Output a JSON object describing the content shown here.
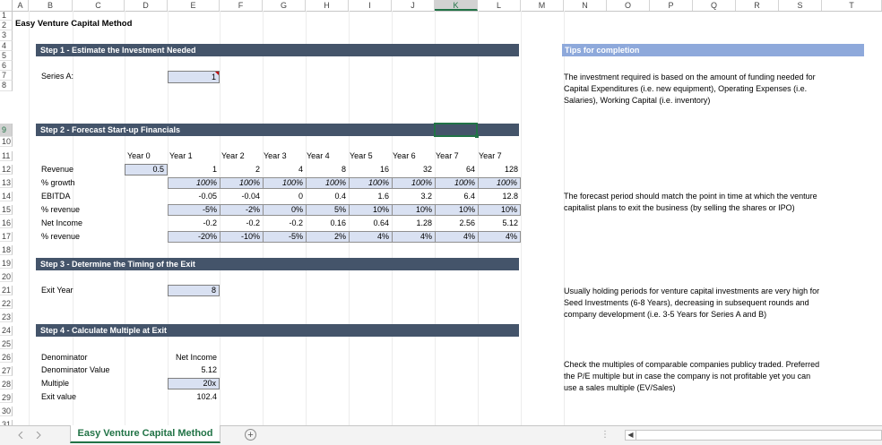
{
  "sheet": {
    "columns": [
      "A",
      "B",
      "C",
      "D",
      "E",
      "F",
      "G",
      "H",
      "I",
      "J",
      "K",
      "L",
      "M",
      "N",
      "O",
      "P",
      "Q",
      "R",
      "S",
      "T"
    ],
    "selected_column": "K",
    "rows": [
      "1",
      "2",
      "3",
      "4",
      "5",
      "6",
      "7",
      "8",
      "9",
      "10",
      "11",
      "12",
      "13",
      "14",
      "15",
      "16",
      "17",
      "18",
      "19",
      "20",
      "21",
      "22",
      "23",
      "24",
      "25",
      "26",
      "27",
      "28",
      "29",
      "30",
      "31"
    ],
    "selected_row": "9"
  },
  "title": "Easy Venture Capital Method",
  "step1": {
    "header": "Step 1 - Estimate the Investment Needed",
    "label": "Series A:",
    "value": "1"
  },
  "step2": {
    "header": "Step 2 - Forecast Start-up Financials",
    "years": [
      "Year 0",
      "Year 1",
      "Year 2",
      "Year 3",
      "Year 4",
      "Year 5",
      "Year 6",
      "Year 7",
      "Year 7"
    ],
    "rows": [
      {
        "label": "Revenue",
        "values": [
          "0.5",
          "1",
          "2",
          "4",
          "8",
          "16",
          "32",
          "64",
          "128"
        ]
      },
      {
        "label": "% growth",
        "values": [
          "",
          "100%",
          "100%",
          "100%",
          "100%",
          "100%",
          "100%",
          "100%",
          "100%"
        ]
      },
      {
        "label": "EBITDA",
        "values": [
          "",
          "-0.05",
          "-0.04",
          "0",
          "0.4",
          "1.6",
          "3.2",
          "6.4",
          "12.8"
        ]
      },
      {
        "label": "% revenue",
        "values": [
          "",
          "-5%",
          "-2%",
          "0%",
          "5%",
          "10%",
          "10%",
          "10%",
          "10%"
        ]
      },
      {
        "label": "Net Income",
        "values": [
          "",
          "-0.2",
          "-0.2",
          "-0.2",
          "0.16",
          "0.64",
          "1.28",
          "2.56",
          "5.12"
        ]
      },
      {
        "label": "% revenue",
        "values": [
          "",
          "-20%",
          "-10%",
          "-5%",
          "2%",
          "4%",
          "4%",
          "4%",
          "4%"
        ]
      }
    ]
  },
  "step3": {
    "header": "Step 3 - Determine the Timing of the Exit",
    "label": "Exit Year",
    "value": "8"
  },
  "step4": {
    "header": "Step 4 - Calculate Multiple at Exit",
    "rows": [
      {
        "label": "Denominator",
        "value": "Net Income"
      },
      {
        "label": "Denominator Value",
        "value": "5.12"
      },
      {
        "label": "Multiple",
        "value": "20x"
      },
      {
        "label": "Exit value",
        "value": "102.4"
      }
    ]
  },
  "tips": {
    "header": "Tips for completion",
    "t1": [
      "The investment required is based on the amount of funding needed for",
      "Capital Expenditures (i.e. new equipment), Operating Expenses (i.e.",
      "Salaries), Working Capital (i.e. inventory)"
    ],
    "t2": [
      "The forecast period should match the point in time at which the venture",
      "capitalist plans to exit the business (by selling the shares or IPO)"
    ],
    "t3": [
      "Usually holding periods for venture capital investments are very high for",
      "Seed Investments (6-8 Years), decreasing in subsequent rounds and",
      "company development (i.e. 3-5 Years for Series A and B)"
    ],
    "t4": [
      "Check the multiples of comparable companies publicy traded. Preferred",
      "the P/E multiple but in case the company is not profitable yet you can",
      "use a sales multiple (EV/Sales)"
    ]
  },
  "tabs": {
    "active": "Easy Venture Capital Method",
    "add": "+",
    "dots": "⋮",
    "scroll_left": "◀"
  },
  "colors": {
    "section_band": "#44546a",
    "tip_band": "#8ea9db",
    "input_fill": "#d9e1f2",
    "excel_green": "#217346"
  }
}
